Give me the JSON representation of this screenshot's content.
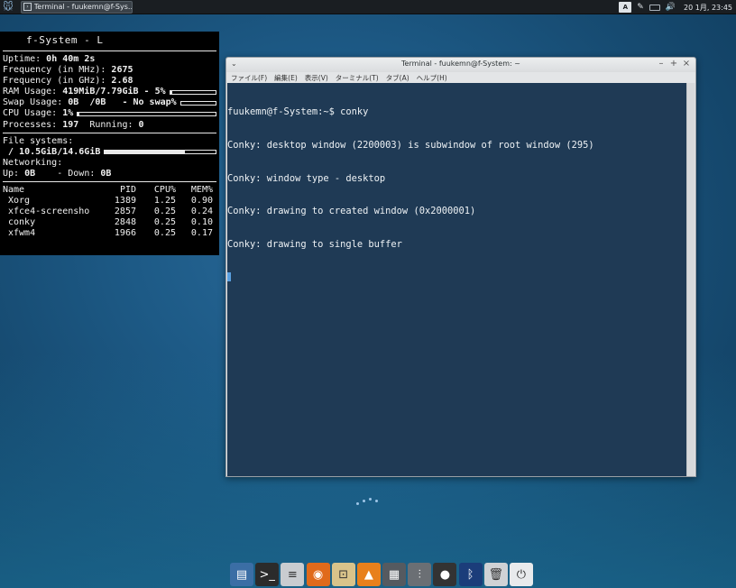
{
  "top_panel": {
    "task_label": "Terminal - fuukemn@f-Sys...",
    "clock": "20 1月, 23:45",
    "ime_label": "A"
  },
  "conky": {
    "title": "f-System - L",
    "uptime_label": "Uptime: ",
    "uptime_value": "0h 40m 2s",
    "freq_mhz_label": "Frequency (in MHz): ",
    "freq_mhz_value": "2675",
    "freq_ghz_label": "Frequency (in GHz): ",
    "freq_ghz_value": "2.68",
    "ram_label": "RAM Usage: ",
    "ram_value": "419MiB/7.79GiB - 5%",
    "ram_fraction": 0.05,
    "swap_label": "Swap Usage: ",
    "swap_value": "0B  /0B   - No swap%",
    "swap_fraction": 0.0,
    "cpu_label": "CPU Usage: ",
    "cpu_value": "1%",
    "cpu_fraction": 0.01,
    "processes_label": "Processes: ",
    "processes_value": "197",
    "running_label": "  Running: ",
    "running_value": "0",
    "filesystems_label": "File systems:",
    "fs_value": " / 10.5GiB/14.6GiB",
    "fs_fraction": 0.72,
    "networking_label": "Networking:",
    "up_label": "Up: ",
    "up_value": "0B",
    "down_label": "    - Down: ",
    "down_value": "0B",
    "proc_headers": [
      "Name",
      "PID",
      "CPU%",
      "MEM%"
    ],
    "processes": [
      {
        "name": "Xorg",
        "pid": "1389",
        "cpu": "1.25",
        "mem": "0.90"
      },
      {
        "name": "xfce4-screensho",
        "pid": "2857",
        "cpu": "0.25",
        "mem": "0.24"
      },
      {
        "name": "conky",
        "pid": "2848",
        "cpu": "0.25",
        "mem": "0.10"
      },
      {
        "name": "xfwm4",
        "pid": "1966",
        "cpu": "0.25",
        "mem": "0.17"
      }
    ]
  },
  "terminal": {
    "title": "Terminal - fuukemn@f-System: ~",
    "menu": [
      "ファイル(F)",
      "編集(E)",
      "表示(V)",
      "ターミナル(T)",
      "タブ(A)",
      "ヘルプ(H)"
    ],
    "lines": [
      "fuukemn@f-System:~$ conky",
      "Conky: desktop window (2200003) is subwindow of root window (295)",
      "Conky: window type - desktop",
      "Conky: drawing to created window (0x2000001)",
      "Conky: drawing to single buffer"
    ],
    "bg_color": "#1f3a55"
  },
  "dock": {
    "items": [
      {
        "icon": "file-manager-icon",
        "glyph": "▤",
        "color": "#3b6ea5"
      },
      {
        "icon": "terminal-icon",
        "glyph": ">_",
        "color": "#2b2b2b"
      },
      {
        "icon": "text-editor-icon",
        "glyph": "≡",
        "color": "#c9ccd0"
      },
      {
        "icon": "firefox-icon",
        "glyph": "◉",
        "color": "#e06a1b"
      },
      {
        "icon": "screenshot-icon",
        "glyph": "⊡",
        "color": "#d9c38a"
      },
      {
        "icon": "vlc-icon",
        "glyph": "▲",
        "color": "#e8801c"
      },
      {
        "icon": "video-editor-icon",
        "glyph": "▦",
        "color": "#555a60"
      },
      {
        "icon": "mixer-icon",
        "glyph": "⫶",
        "color": "#6b6f74"
      },
      {
        "icon": "media-player-icon",
        "glyph": "●",
        "color": "#333"
      },
      {
        "icon": "bluetooth-icon",
        "glyph": "ᛒ",
        "color": "#1b3d7a"
      },
      {
        "icon": "trash-icon",
        "glyph": "🗑",
        "color": "#cfd2d5"
      },
      {
        "icon": "logout-icon",
        "glyph": "⏻",
        "color": "#e8eaec"
      }
    ]
  }
}
